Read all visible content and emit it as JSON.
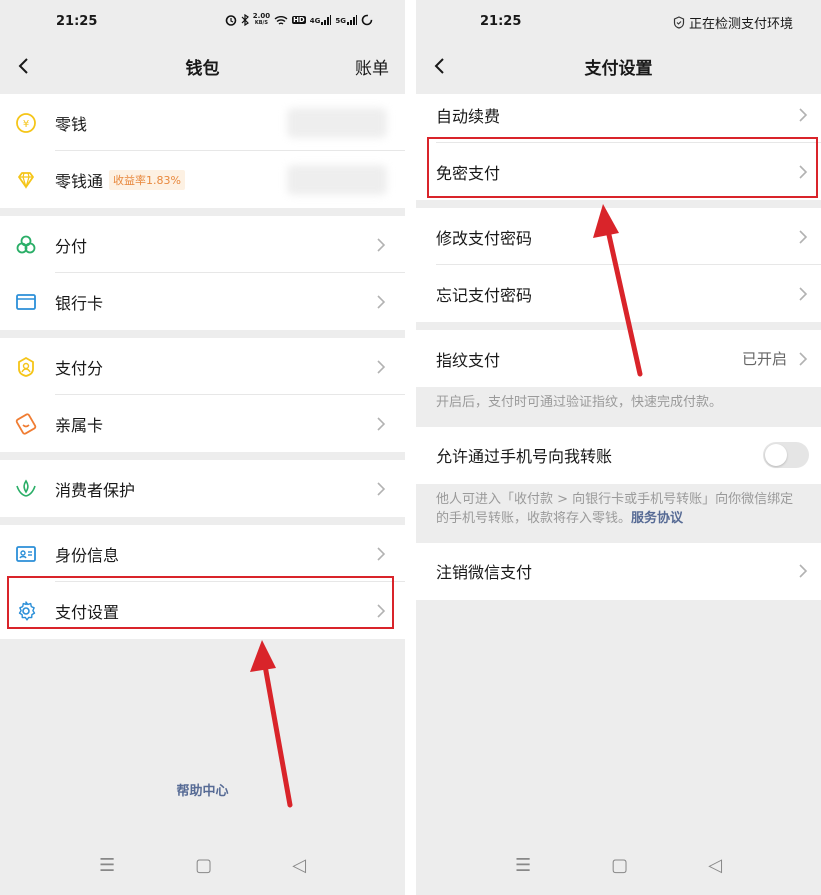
{
  "left": {
    "status": {
      "time": "21:25",
      "speed_value": "2.00",
      "speed_unit": "KB/S",
      "hd_badge": "HD",
      "net1": "4G",
      "net2": "5G"
    },
    "nav": {
      "title": "钱包",
      "right": "账单"
    },
    "groups": [
      {
        "items": [
          {
            "label": "零钱",
            "icon": "coin-yen-icon"
          },
          {
            "label": "零钱通",
            "icon": "diamond-icon",
            "badge": "收益率1.83%"
          }
        ]
      },
      {
        "items": [
          {
            "label": "分付",
            "icon": "clover-icon"
          },
          {
            "label": "银行卡",
            "icon": "card-icon"
          }
        ]
      },
      {
        "items": [
          {
            "label": "支付分",
            "icon": "score-badge-icon"
          },
          {
            "label": "亲属卡",
            "icon": "family-card-icon"
          }
        ]
      },
      {
        "items": [
          {
            "label": "消费者保护",
            "icon": "shield-hands-icon"
          }
        ]
      },
      {
        "items": [
          {
            "label": "身份信息",
            "icon": "id-card-icon"
          },
          {
            "label": "支付设置",
            "icon": "gear-icon"
          }
        ]
      }
    ],
    "help": "帮助中心"
  },
  "right": {
    "status": {
      "time": "21:25",
      "notice": "正在检测支付环境"
    },
    "nav": {
      "title": "支付设置"
    },
    "items": {
      "auto_renew": "自动续费",
      "no_pwd_pay": "免密支付",
      "change_pwd": "修改支付密码",
      "forgot_pwd": "忘记支付密码",
      "fingerprint": "指纹支付",
      "fingerprint_status": "已开启",
      "fingerprint_desc": "开启后，支付时可通过验证指纹，快速完成付款。",
      "phone_transfer": "允许通过手机号向我转账",
      "phone_transfer_desc": "他人可进入「收付款 > 向银行卡或手机号转账」向你微信绑定的手机号转账，收款将存入零钱。",
      "service_agreement": "服务协议",
      "deregister": "注销微信支付"
    }
  },
  "bottom_nav": {
    "menu": "☰",
    "home": "▢",
    "back": "◁"
  },
  "colors": {
    "highlight": "#d9242a",
    "arrow": "#d9242a",
    "link": "#576b95",
    "badge_text": "#e8883d",
    "icon_green": "#2aae67",
    "icon_yellow": "#f5c518",
    "icon_blue": "#2b8fd8",
    "icon_orange": "#f07d33"
  }
}
